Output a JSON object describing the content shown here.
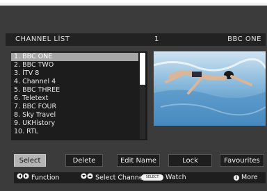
{
  "header": {
    "title": "CHANNEL LİST",
    "channel_number": "1",
    "channel_name": "BBC ONE"
  },
  "channels": [
    "1. BBC ONE",
    "2. BBC TWO",
    "3. İTV 8",
    "4. Channel 4",
    "5. BBC THREE",
    "6. Teletext",
    "7. BBC FOUR",
    "8. Sky Travel",
    "9. UKHistory",
    "10. RTL"
  ],
  "selected_index": 0,
  "buttons": {
    "select": "Select",
    "delete": "Delete",
    "edit_name": "Edit Name",
    "lock": "Lock",
    "favourites": "Favourites"
  },
  "legend": {
    "function": "Function",
    "select_channel": "Select Channel",
    "select_key": "SELECT",
    "watch": "Watch",
    "info_key": "i",
    "more": "More"
  },
  "icons": {
    "left_right": "left-right-arrows-icon",
    "up_down": "up-down-arrows-icon",
    "select_key": "select-key-icon",
    "info": "info-icon"
  },
  "colors": {
    "selected_row": "#a7a7a7",
    "active_button": "#b4b4b4",
    "panel": "#1c1c1c"
  }
}
